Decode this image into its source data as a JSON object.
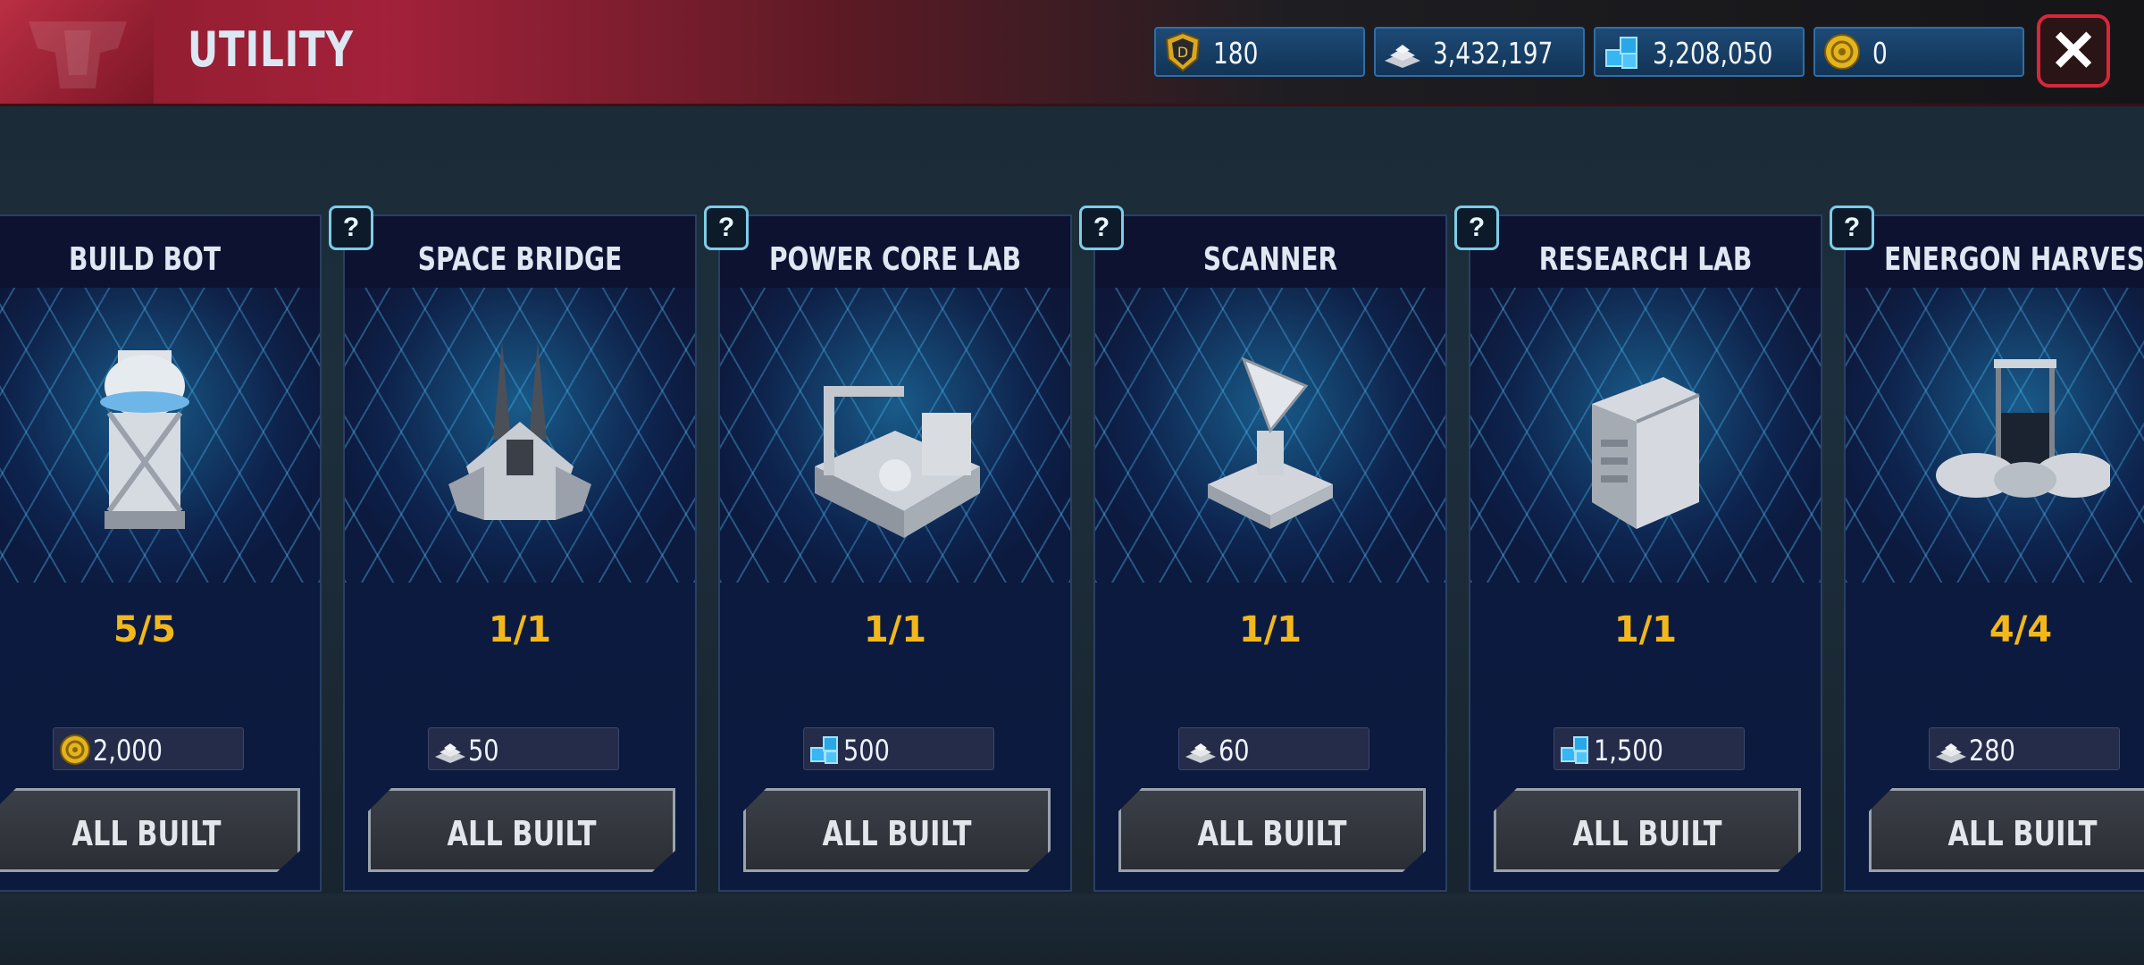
{
  "header": {
    "title": "UTILITY",
    "resources": [
      {
        "name": "medal-icon",
        "value": "180"
      },
      {
        "name": "alloy-icon",
        "value": "3,432,197"
      },
      {
        "name": "energon-icon",
        "value": "3,208,050"
      },
      {
        "name": "gold-icon",
        "value": "0"
      }
    ],
    "close_label": "✕"
  },
  "help_label": "?",
  "cards": [
    {
      "name": "BUILD BOT",
      "count": "5/5",
      "cost": "2,000",
      "cost_icon": "gold-icon",
      "button": "ALL BUILT"
    },
    {
      "name": "SPACE BRIDGE",
      "count": "1/1",
      "cost": "50",
      "cost_icon": "alloy-icon",
      "button": "ALL BUILT"
    },
    {
      "name": "POWER CORE LAB",
      "count": "1/1",
      "cost": "500",
      "cost_icon": "energon-icon",
      "button": "ALL BUILT"
    },
    {
      "name": "SCANNER",
      "count": "1/1",
      "cost": "60",
      "cost_icon": "alloy-icon",
      "button": "ALL BUILT"
    },
    {
      "name": "RESEARCH LAB",
      "count": "1/1",
      "cost": "1,500",
      "cost_icon": "energon-icon",
      "button": "ALL BUILT"
    },
    {
      "name": "ENERGON HARVESTER",
      "count": "4/4",
      "cost": "280",
      "cost_icon": "alloy-icon",
      "button": "ALL BUILT"
    }
  ],
  "colors": {
    "accent": "#a3213a",
    "count": "#f2b71a",
    "panel": "#0c1a40"
  }
}
